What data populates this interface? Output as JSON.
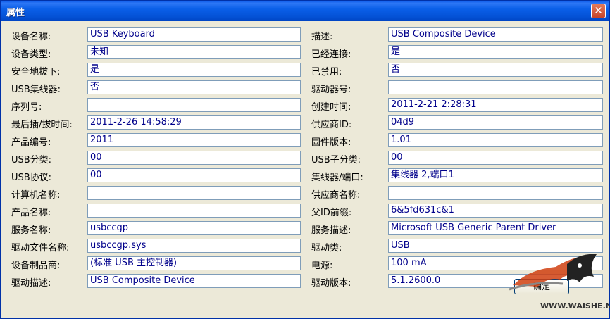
{
  "window": {
    "title": "属性",
    "close_glyph": "✕"
  },
  "rows": [
    {
      "left_label": "设备名称:",
      "left_value": "USB Keyboard",
      "right_label": "描述:",
      "right_value": "USB Composite Device"
    },
    {
      "left_label": "设备类型:",
      "left_value": "未知",
      "right_label": "已经连接:",
      "right_value": "是"
    },
    {
      "left_label": "安全地拔下:",
      "left_value": "是",
      "right_label": "已禁用:",
      "right_value": "否"
    },
    {
      "left_label": "USB集线器:",
      "left_value": "否",
      "right_label": "驱动器号:",
      "right_value": ""
    },
    {
      "left_label": "序列号:",
      "left_value": "",
      "right_label": "创建时间:",
      "right_value": "2011-2-21 2:28:31"
    },
    {
      "left_label": "最后插/拔时间:",
      "left_value": "2011-2-26 14:58:29",
      "right_label": "供应商ID:",
      "right_value": "04d9"
    },
    {
      "left_label": "产品编号:",
      "left_value": "2011",
      "right_label": "固件版本:",
      "right_value": "1.01"
    },
    {
      "left_label": "USB分类:",
      "left_value": "00",
      "right_label": "USB子分类:",
      "right_value": "00"
    },
    {
      "left_label": "USB协议:",
      "left_value": "00",
      "right_label": "集线器/端口:",
      "right_value": "集线器 2,端口1"
    },
    {
      "left_label": "计算机名称:",
      "left_value": "",
      "right_label": "供应商名称:",
      "right_value": ""
    },
    {
      "left_label": "产品名称:",
      "left_value": "",
      "right_label": "父ID前缀:",
      "right_value": "6&5fd631c&1"
    },
    {
      "left_label": "服务名称:",
      "left_value": "usbccgp",
      "right_label": "服务描述:",
      "right_value": "Microsoft USB Generic Parent Driver"
    },
    {
      "left_label": "驱动文件名称:",
      "left_value": "usbccgp.sys",
      "right_label": "驱动类:",
      "right_value": "USB"
    },
    {
      "left_label": "设备制品商:",
      "left_value": "(标准 USB 主控制器)",
      "right_label": "电源:",
      "right_value": "100 mA"
    },
    {
      "left_label": "驱动描述:",
      "left_value": "USB Composite Device",
      "right_label": "驱动版本:",
      "right_value": "5.1.2600.0"
    }
  ],
  "ok_button": {
    "label": "确定"
  },
  "watermark": {
    "text": "WWW.WAISHE.NET"
  },
  "colors": {
    "title_bar": "#0a5fe8",
    "value_text": "#00008b",
    "dialog_bg": "#ece9d8"
  }
}
